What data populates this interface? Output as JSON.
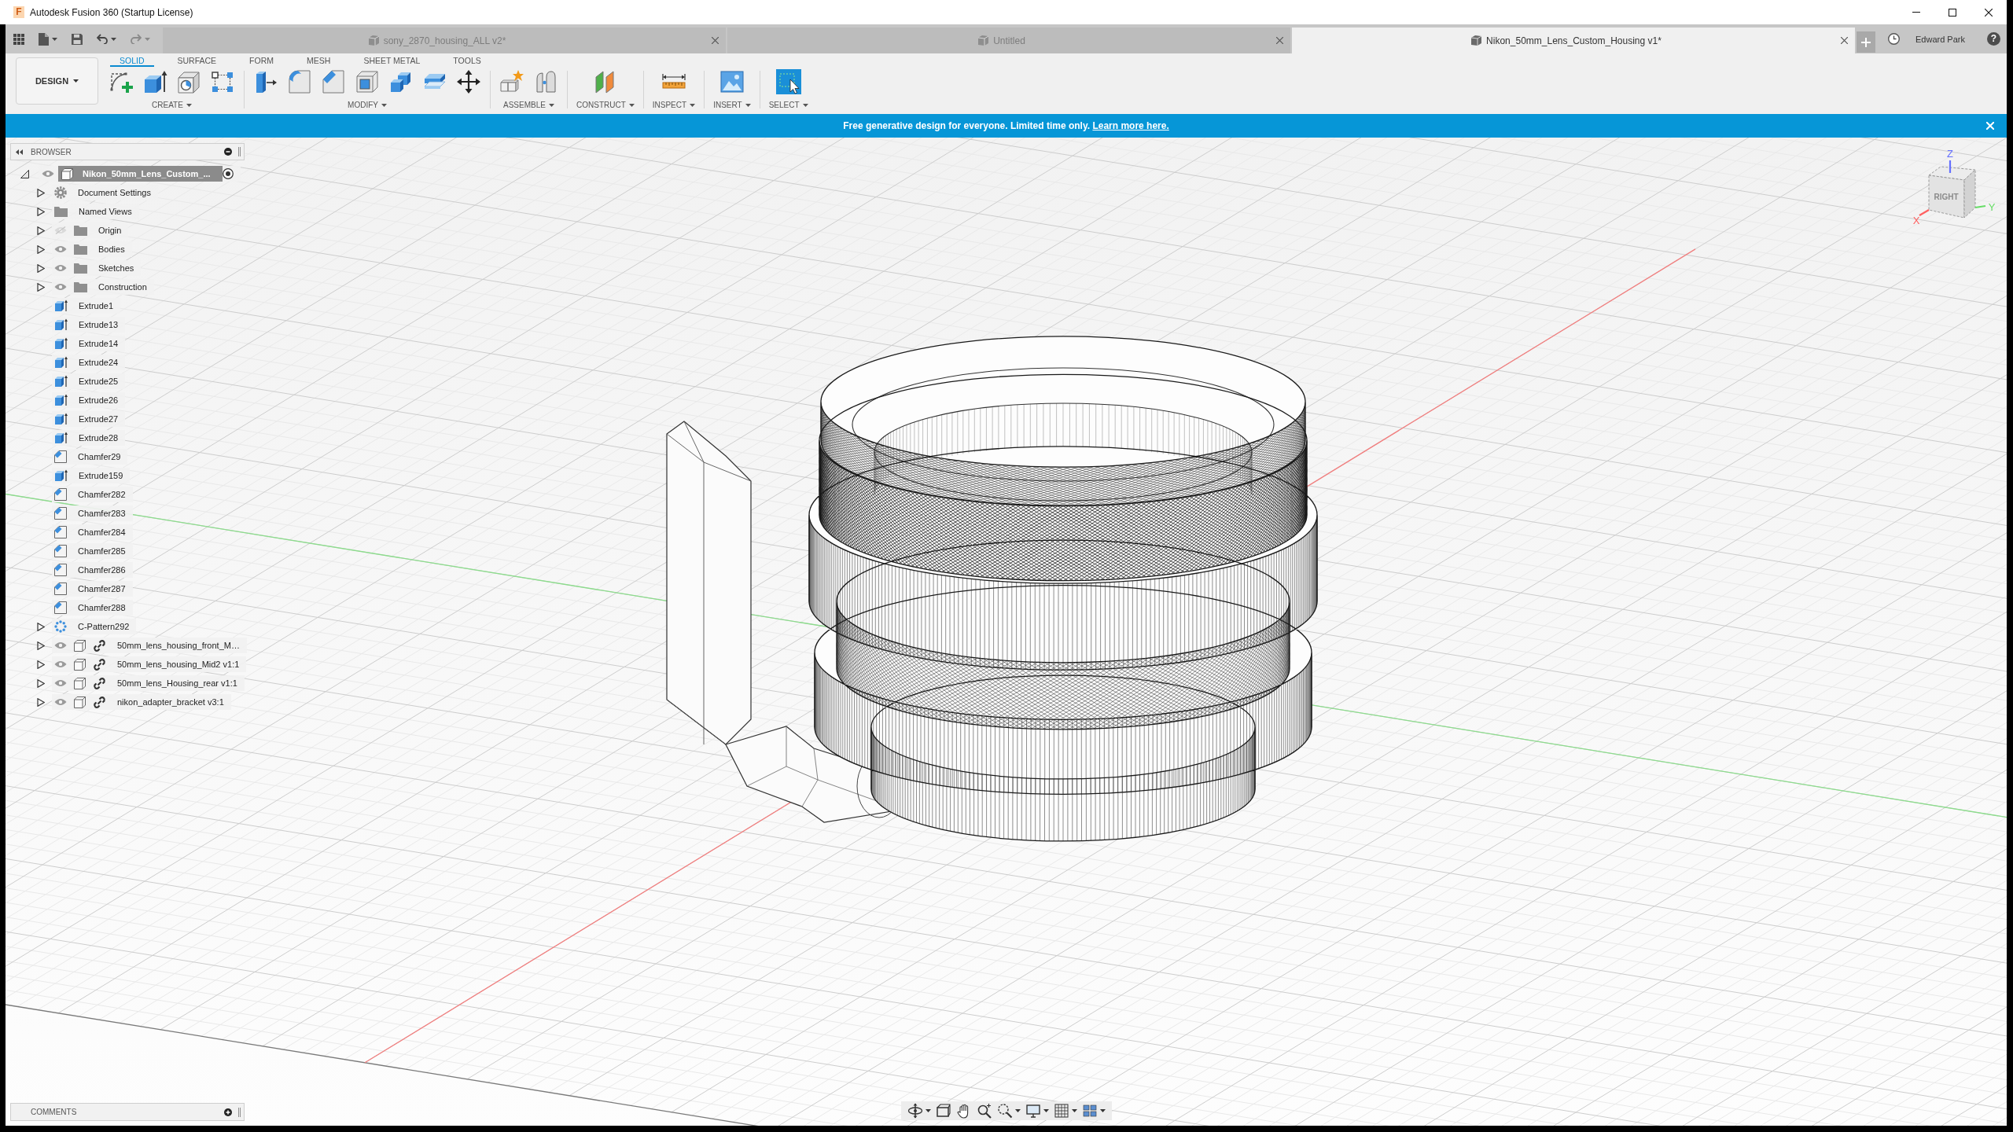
{
  "window": {
    "logo_letter": "F",
    "title": "Autodesk Fusion 360 (Startup License)"
  },
  "document_tabs": [
    {
      "title": "sony_2870_housing_ALL v2*",
      "selected": false
    },
    {
      "title": "Untitled",
      "selected": false
    },
    {
      "title": "Nikon_50mm_Lens_Custom_Housing v1*",
      "selected": true
    }
  ],
  "account": {
    "user_name": "Edward Park",
    "help": "?"
  },
  "workspace": {
    "label": "DESIGN"
  },
  "toolbar_tabs": [
    {
      "label": "SOLID",
      "selected": true
    },
    {
      "label": "SURFACE",
      "selected": false
    },
    {
      "label": "FORM",
      "selected": false
    },
    {
      "label": "MESH",
      "selected": false
    },
    {
      "label": "SHEET METAL",
      "selected": false
    },
    {
      "label": "TOOLS",
      "selected": false
    }
  ],
  "tool_groups": [
    {
      "label": "CREATE"
    },
    {
      "label": "MODIFY"
    },
    {
      "label": "ASSEMBLE"
    },
    {
      "label": "CONSTRUCT"
    },
    {
      "label": "INSPECT"
    },
    {
      "label": "INSERT"
    },
    {
      "label": "SELECT"
    }
  ],
  "banner": {
    "message": "Free generative design for everyone. Limited time only.",
    "link": "Learn more here."
  },
  "browser": {
    "title": "BROWSER",
    "root": {
      "label": "Nikon_50mm_Lens_Custom_...",
      "expanded": true,
      "visible": true,
      "active": true,
      "children": [
        {
          "label": "Document Settings",
          "kind": "settings",
          "expanded": false
        },
        {
          "label": "Named Views",
          "kind": "folder",
          "expanded": false
        },
        {
          "label": "Origin",
          "kind": "folder",
          "expanded": false,
          "visible": false
        },
        {
          "label": "Bodies",
          "kind": "folder",
          "expanded": false,
          "visible": true
        },
        {
          "label": "Sketches",
          "kind": "folder",
          "expanded": false,
          "visible": true
        },
        {
          "label": "Construction",
          "kind": "folder",
          "expanded": false,
          "visible": true
        },
        {
          "label": "Extrude1",
          "kind": "extrude"
        },
        {
          "label": "Extrude13",
          "kind": "extrude"
        },
        {
          "label": "Extrude14",
          "kind": "extrude"
        },
        {
          "label": "Extrude24",
          "kind": "extrude"
        },
        {
          "label": "Extrude25",
          "kind": "extrude"
        },
        {
          "label": "Extrude26",
          "kind": "extrude"
        },
        {
          "label": "Extrude27",
          "kind": "extrude"
        },
        {
          "label": "Extrude28",
          "kind": "extrude"
        },
        {
          "label": "Chamfer29",
          "kind": "chamfer"
        },
        {
          "label": "Extrude159",
          "kind": "extrude"
        },
        {
          "label": "Chamfer282",
          "kind": "chamfer"
        },
        {
          "label": "Chamfer283",
          "kind": "chamfer"
        },
        {
          "label": "Chamfer284",
          "kind": "chamfer"
        },
        {
          "label": "Chamfer285",
          "kind": "chamfer"
        },
        {
          "label": "Chamfer286",
          "kind": "chamfer"
        },
        {
          "label": "Chamfer287",
          "kind": "chamfer"
        },
        {
          "label": "Chamfer288",
          "kind": "chamfer"
        },
        {
          "label": "C-Pattern292",
          "kind": "pattern",
          "expanded": false
        },
        {
          "label": "50mm_lens_housing_front_M…",
          "kind": "linked_component",
          "expanded": false,
          "visible": true
        },
        {
          "label": "50mm_lens_housing_Mid2 v1:1",
          "kind": "linked_component",
          "expanded": false,
          "visible": true
        },
        {
          "label": "50mm_lens_Housing_rear v1:1",
          "kind": "linked_component",
          "expanded": false,
          "visible": true
        },
        {
          "label": "nikon_adapter_bracket v3:1",
          "kind": "linked_component",
          "expanded": false,
          "visible": true
        }
      ]
    }
  },
  "viewcube": {
    "face": "RIGHT",
    "axes": [
      {
        "label": "Z",
        "color": "#6570ff"
      },
      {
        "label": "X",
        "color": "#ff6060"
      },
      {
        "label": "Y",
        "color": "#66dd66"
      }
    ]
  },
  "comments": {
    "title": "COMMENTS"
  }
}
